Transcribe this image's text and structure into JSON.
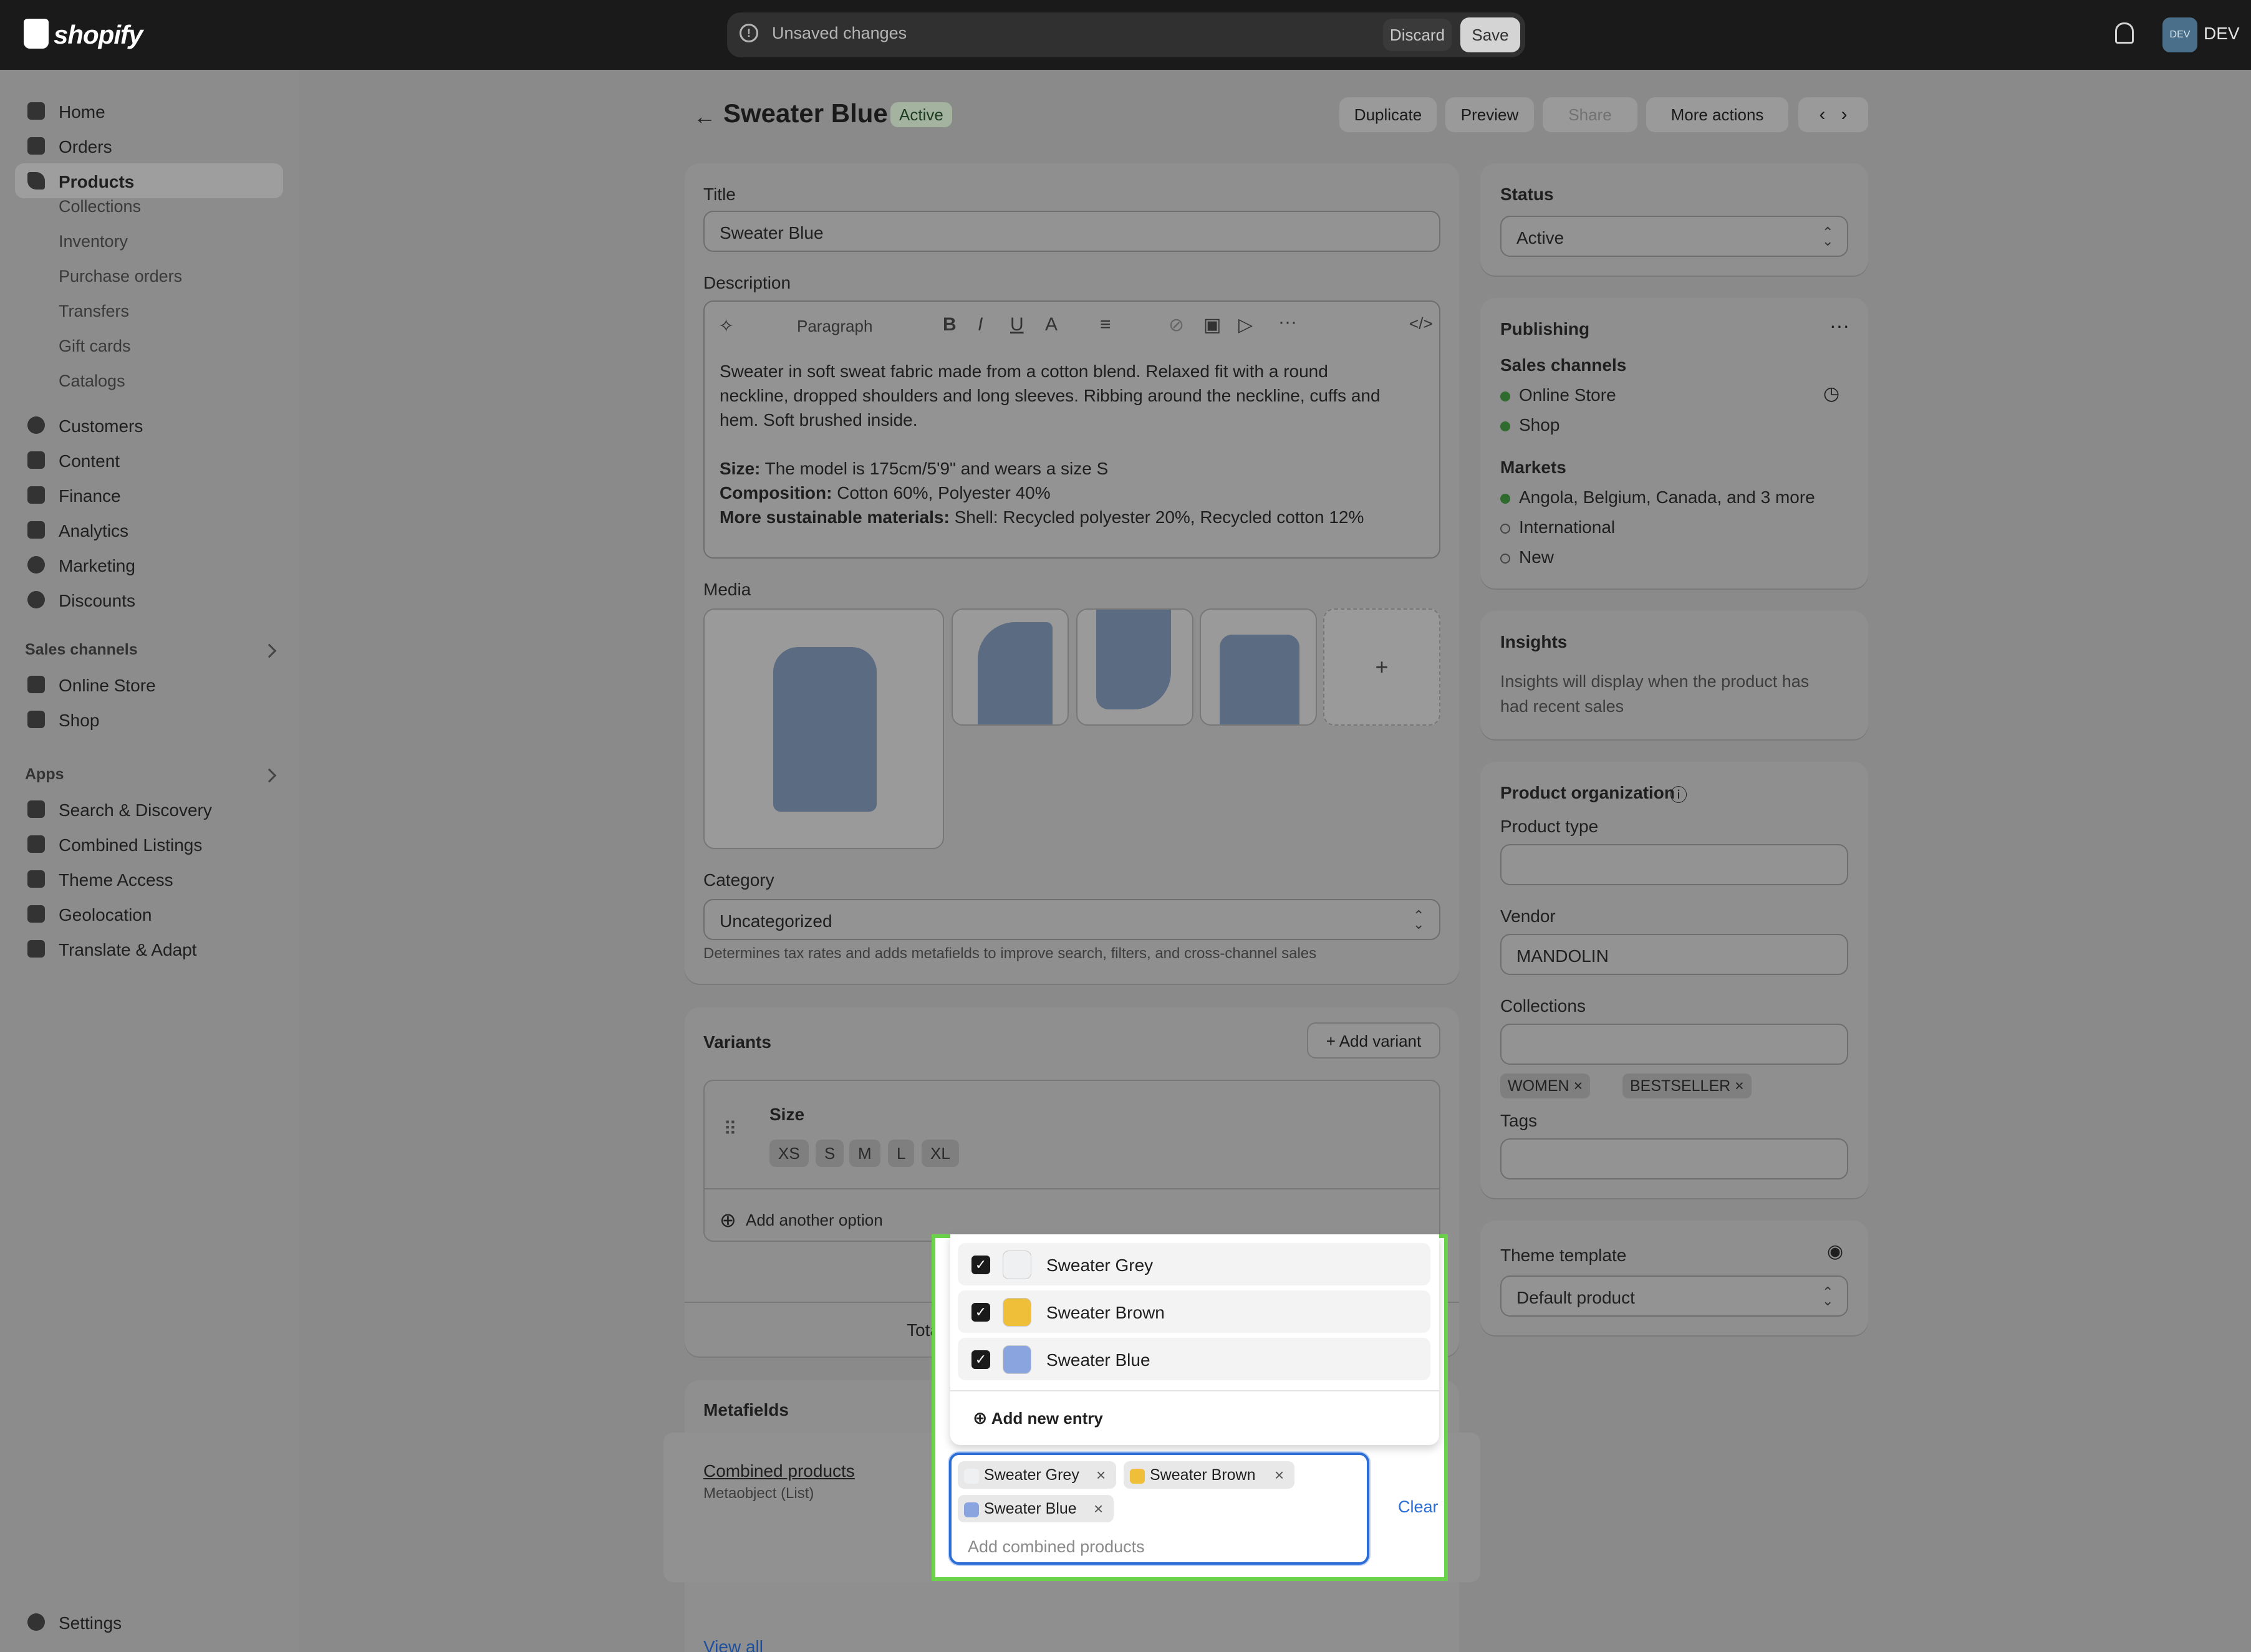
{
  "topbar": {
    "logo_text": "shopify",
    "unsaved_text": "Unsaved changes",
    "discard_label": "Discard",
    "save_label": "Save",
    "avatar_initials": "DEV",
    "user_label": "DEV"
  },
  "sidebar": {
    "main": [
      {
        "label": "Home",
        "icon": "home-icon"
      },
      {
        "label": "Orders",
        "icon": "inbox-icon"
      },
      {
        "label": "Products",
        "icon": "tag-icon"
      }
    ],
    "products_sub": [
      "Collections",
      "Inventory",
      "Purchase orders",
      "Transfers",
      "Gift cards",
      "Catalogs"
    ],
    "secondary": [
      {
        "label": "Customers",
        "icon": "person-icon"
      },
      {
        "label": "Content",
        "icon": "content-icon"
      },
      {
        "label": "Finance",
        "icon": "bank-icon"
      },
      {
        "label": "Analytics",
        "icon": "chart-icon"
      },
      {
        "label": "Marketing",
        "icon": "target-icon"
      },
      {
        "label": "Discounts",
        "icon": "discount-icon"
      }
    ],
    "sales_channels_label": "Sales channels",
    "sales_channels": [
      "Online Store",
      "Shop"
    ],
    "apps_label": "Apps",
    "apps": [
      "Search & Discovery",
      "Combined Listings",
      "Theme Access",
      "Geolocation",
      "Translate & Adapt"
    ],
    "settings_label": "Settings"
  },
  "header": {
    "title": "Sweater Blue",
    "status_badge": "Active",
    "duplicate": "Duplicate",
    "preview": "Preview",
    "share": "Share",
    "more_actions": "More actions"
  },
  "product": {
    "title_label": "Title",
    "title_value": "Sweater Blue",
    "description_label": "Description",
    "paragraph_select": "Paragraph",
    "desc_line1": "Sweater in soft sweat fabric made from a cotton blend. Relaxed fit with a round",
    "desc_line2": "neckline, dropped shoulders and long sleeves. Ribbing around the neckline, cuffs and",
    "desc_line3": "hem. Soft brushed inside.",
    "size_label": "Size:",
    "size_value": " The model is 175cm/5'9\" and wears a size S",
    "composition_label": "Composition:",
    "composition_value": " Cotton 60%, Polyester 40%",
    "sustainable_label": "More sustainable materials:",
    "sustainable_value": " Shell: Recycled polyester 20%, Recycled cotton 12%",
    "media_label": "Media",
    "media_add": "+",
    "category_label": "Category",
    "category_value": "Uncategorized",
    "category_help": "Determines tax rates and adds metafields to improve search, filters, and cross-channel sales"
  },
  "variants": {
    "title": "Variants",
    "add_variant": "Add variant",
    "option_name": "Size",
    "option_values": [
      "XS",
      "S",
      "M",
      "L",
      "XL"
    ],
    "add_option": "Add another option",
    "total_partial": "Total i"
  },
  "metafields": {
    "title": "Metafields",
    "combined_label": "Combined products",
    "combined_type": "Metaobject (List)",
    "view_all": "View all"
  },
  "dropdown": {
    "options": [
      {
        "label": "Sweater Grey",
        "color": "#eef0f2",
        "checked": true
      },
      {
        "label": "Sweater Brown",
        "color": "#f0bf3a",
        "checked": true
      },
      {
        "label": "Sweater Blue",
        "color": "#8aa4e0",
        "checked": true
      }
    ],
    "add_new": "Add new entry",
    "selected": [
      {
        "label": "Sweater Grey",
        "color": "#eef0f2"
      },
      {
        "label": "Sweater Brown",
        "color": "#f0bf3a"
      },
      {
        "label": "Sweater Blue",
        "color": "#8aa4e0"
      }
    ],
    "placeholder": "Add combined products",
    "clear": "Clear"
  },
  "status_card": {
    "title": "Status",
    "value": "Active"
  },
  "publishing": {
    "title": "Publishing",
    "sales_channels_label": "Sales channels",
    "channels": [
      "Online Store",
      "Shop"
    ],
    "markets_label": "Markets",
    "markets": [
      {
        "label": "Angola, Belgium, Canada, and 3 more",
        "active": true
      },
      {
        "label": "International",
        "active": false
      },
      {
        "label": "New",
        "active": false
      }
    ]
  },
  "insights": {
    "title": "Insights",
    "text_line1": "Insights will display when the product has",
    "text_line2": "had recent sales"
  },
  "organization": {
    "title": "Product organization",
    "product_type_label": "Product type",
    "vendor_label": "Vendor",
    "vendor_value": "MANDOLIN",
    "collections_label": "Collections",
    "collection_tags": [
      "WOMEN",
      "BESTSELLER"
    ],
    "tags_label": "Tags"
  },
  "theme": {
    "title": "Theme template",
    "value": "Default product"
  }
}
